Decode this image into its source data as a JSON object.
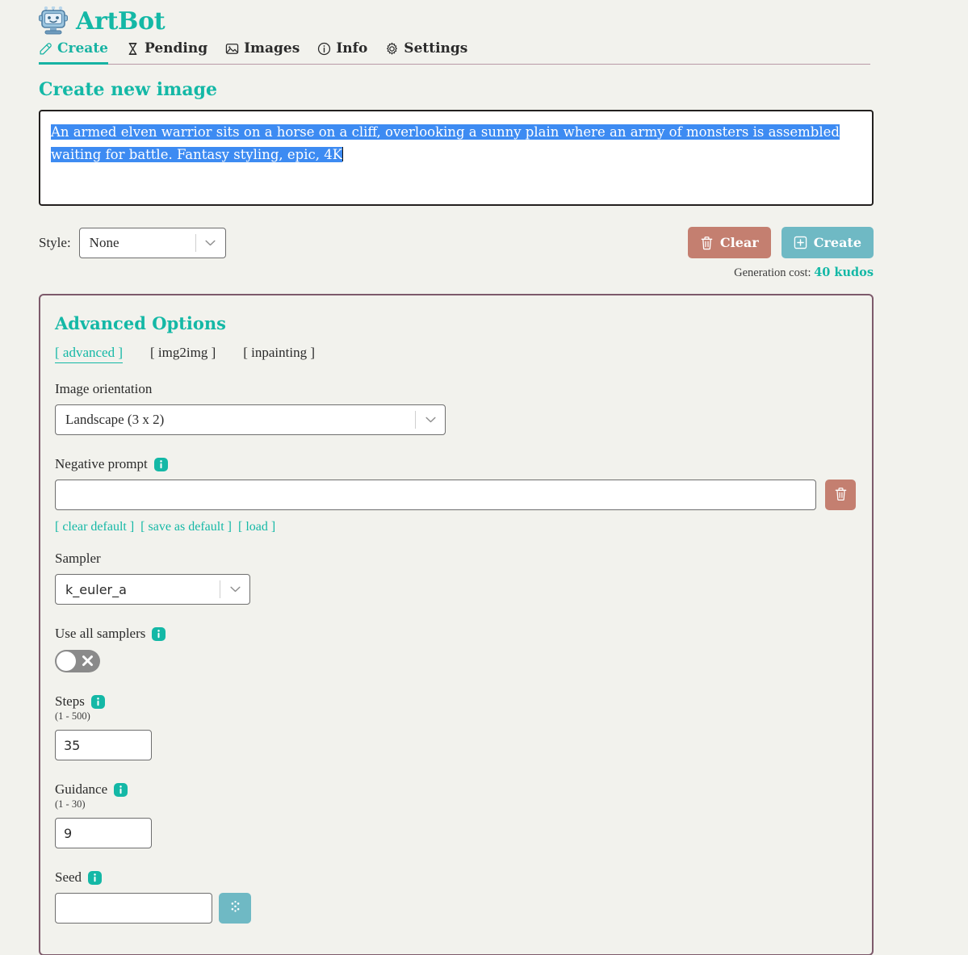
{
  "app": {
    "name": "ArtBot",
    "logo_icon": "robot-icon"
  },
  "nav": {
    "items": [
      {
        "label": "Create",
        "icon": "pencil-icon",
        "active": true
      },
      {
        "label": "Pending",
        "icon": "hourglass-icon",
        "active": false
      },
      {
        "label": "Images",
        "icon": "image-icon",
        "active": false
      },
      {
        "label": "Info",
        "icon": "info-circle-icon",
        "active": false
      },
      {
        "label": "Settings",
        "icon": "gear-icon",
        "active": false
      }
    ]
  },
  "create": {
    "heading": "Create new image",
    "prompt": {
      "selected_text": "An armed elven warrior sits on a horse on a cliff, overlooking a sunny plain where an army of monsters is assembled waiting for battle. Fantasy styling, epic, 4K",
      "placeholder": ""
    },
    "style": {
      "label": "Style:",
      "value": "None",
      "options": [
        "None"
      ]
    },
    "buttons": {
      "clear": "Clear",
      "create": "Create"
    },
    "cost": {
      "label": "Generation cost:",
      "value": "40 kudos"
    }
  },
  "advanced": {
    "title": "Advanced Options",
    "tabs": [
      {
        "label": "[ advanced ]",
        "active": true
      },
      {
        "label": "[ img2img ]",
        "active": false
      },
      {
        "label": "[ inpainting ]",
        "active": false
      }
    ],
    "orientation": {
      "label": "Image orientation",
      "value": "Landscape (3 x 2)",
      "options": [
        "Landscape (3 x 2)"
      ]
    },
    "negative_prompt": {
      "label": "Negative prompt",
      "value": "",
      "placeholder": "",
      "delete_icon": "trash-icon",
      "links": [
        "[ clear default ]",
        "[ save as default ]",
        "[ load ]"
      ]
    },
    "sampler": {
      "label": "Sampler",
      "value": "k_euler_a",
      "options": [
        "k_euler_a"
      ]
    },
    "use_all_samplers": {
      "label": "Use all samplers",
      "enabled": false,
      "off_glyph": "x-icon"
    },
    "steps": {
      "label": "Steps",
      "range": "(1 - 500)",
      "value": "35"
    },
    "guidance": {
      "label": "Guidance",
      "range": "(1 - 30)",
      "value": "9"
    },
    "seed": {
      "label": "Seed",
      "value": "",
      "placeholder": "",
      "random_icon": "dice-icon"
    }
  },
  "colors": {
    "accent_teal": "#14b8a6",
    "button_teal": "#6fb9c4",
    "button_red": "#c47f70",
    "panel_border": "#7d5a6b",
    "page_bg": "#f2f2ed",
    "selection_blue": "#3d8bf2"
  }
}
